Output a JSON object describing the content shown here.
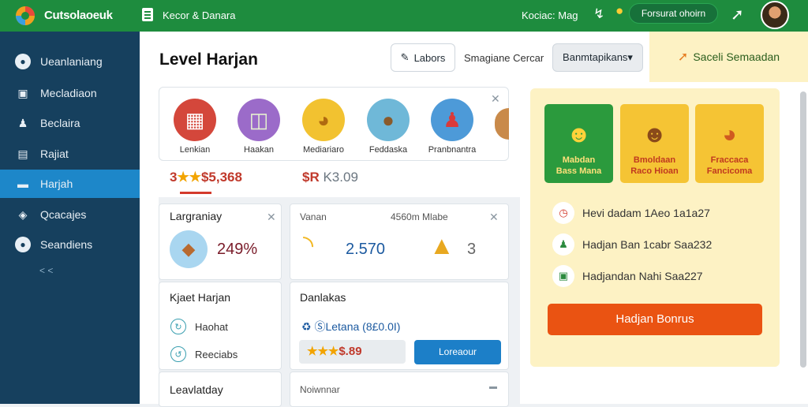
{
  "topbar": {
    "brand": "Cutsolaoeuk",
    "title": "Kecor & Danara",
    "status": "Kociac: Mag",
    "cta": "Forsurat ohoirn",
    "icons": [
      "bolt-icon",
      "pin-icon",
      "rocket-icon"
    ]
  },
  "sidebar": {
    "items": [
      {
        "label": "Ueanlaniang",
        "icon": "info-icon"
      },
      {
        "label": "Mecladiaon",
        "icon": "tablet-icon"
      },
      {
        "label": "Beclaira",
        "icon": "user-icon"
      },
      {
        "label": "Rajiat",
        "icon": "calendar-icon"
      },
      {
        "label": "Harjah",
        "icon": "card-icon",
        "active": true
      },
      {
        "label": "Qcacajes",
        "icon": "tag-icon"
      },
      {
        "label": "Seandiens",
        "icon": "info-icon"
      }
    ],
    "collapse": "< <"
  },
  "header": {
    "title": "Level Harjan",
    "labels_button": "Labors",
    "text": "Smagiane Cercar",
    "select": "Banmtapikans▾",
    "promo": "Saceli Semaadan"
  },
  "categories": [
    {
      "label": "Lenkian",
      "color": "#d4473b"
    },
    {
      "label": "Haakan",
      "color": "#9b6bc9"
    },
    {
      "label": "Mediariaro",
      "color": "#f2c230"
    },
    {
      "label": "Feddaska",
      "color": "#6fb8d8"
    },
    {
      "label": "Pranbnantra",
      "color": "#4d9ad8"
    }
  ],
  "prices": {
    "a_stars": "★★",
    "a_prefix": "3",
    "a_value": "$5,368",
    "b_value": "$R",
    "b_rest": "K3.09"
  },
  "cards": {
    "c1": {
      "title": "Largraniay",
      "value": "249%"
    },
    "c2": {
      "left": "Vanan",
      "right": "4560m Mlabe",
      "value": "2.570",
      "count": "3"
    },
    "c3": {
      "title": "Kjaet Harjan",
      "row1": "Haohat",
      "row2": "Reeciabs"
    },
    "c4": {
      "title": "Danlakas",
      "link": "ⓈLetana (8£0.0I)",
      "price_stars": "★★★",
      "price": "$.89",
      "button": "Loreaour"
    },
    "c5": {
      "title": "Leavlatday"
    },
    "c6": {
      "title": "Noiwnnar"
    }
  },
  "promo": {
    "games": [
      {
        "name": "Mabdan\nBass Mana",
        "bg": "#2b9a3d",
        "text": "#ffe07a"
      },
      {
        "name": "Bmoldaan\nRaco Hioan",
        "bg": "#f5c434",
        "text": "#c0391f"
      },
      {
        "name": "Fraccaca\nFancicoma",
        "bg": "#f5c434",
        "text": "#c0391f"
      }
    ],
    "rows": [
      "Hevi dadam 1Aeo 1a1a27",
      "Hadjan Ban 1cabr Saa232",
      "Hadjandan Nahi Saa227"
    ],
    "button": "Hadjan Bonrus"
  }
}
